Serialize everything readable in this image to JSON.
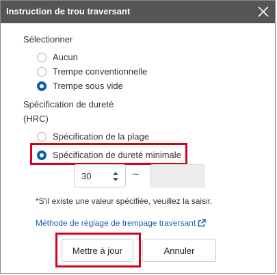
{
  "dialog": {
    "title": "Instruction de trou traversant",
    "close_icon": "close-icon"
  },
  "select_section": {
    "label": "Sélectionner",
    "options": [
      {
        "label": "Aucun",
        "selected": false
      },
      {
        "label": "Trempe conventionnelle",
        "selected": false
      },
      {
        "label": "Trempe sous vide",
        "selected": true
      }
    ]
  },
  "hardness_section": {
    "label": "Spécification de dureté",
    "unit": "(HRC)",
    "options": [
      {
        "label": "Spécification de la plage",
        "selected": false
      },
      {
        "label": "Spécification de dureté minimale",
        "selected": true
      }
    ],
    "min_value": "30",
    "separator": "~",
    "max_value": ""
  },
  "note": "*S'il existe une valeur spécifiée, veuillez la saisir.",
  "link": {
    "label": "Méthode de réglage de trempage traversant",
    "icon": "external-link-icon"
  },
  "buttons": {
    "update": "Mettre à jour",
    "cancel": "Annuler"
  },
  "colors": {
    "titlebar": "#555555",
    "accent": "#0b5fa8",
    "highlight": "#d6001c",
    "link": "#1a5fb4"
  }
}
